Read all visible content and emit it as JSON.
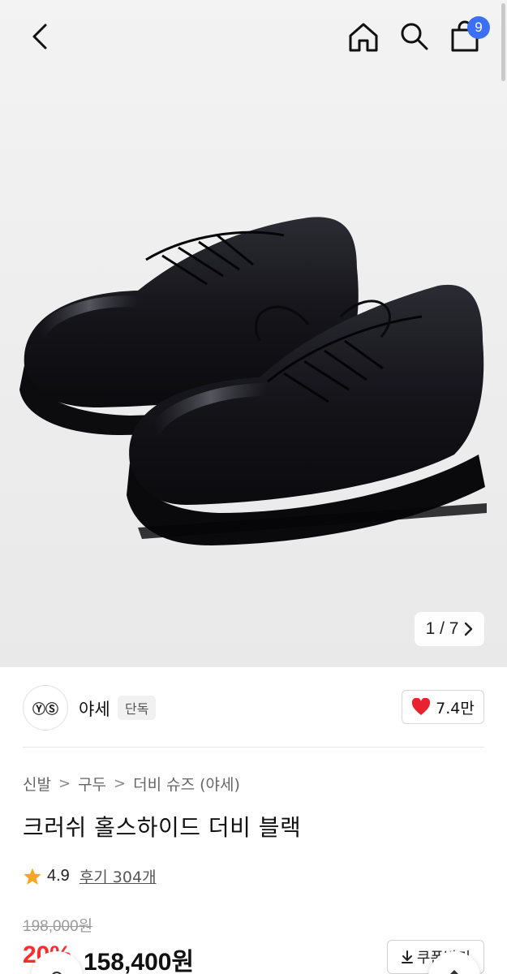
{
  "header": {
    "back_icon": "chevron-left-icon",
    "home_icon": "home-icon",
    "search_icon": "search-icon",
    "cart_icon": "shopping-bag-icon",
    "cart_count": "9",
    "badge_color": "#3b6ff6"
  },
  "gallery": {
    "pager": "1 / 7",
    "pager_icon": "chevron-right-icon"
  },
  "brand": {
    "logo_text": "ⓎⓈ",
    "name": "야세",
    "tag": "단독",
    "likes": "7.4만",
    "like_icon": "heart-icon",
    "heart_color": "#e8232f"
  },
  "breadcrumb": [
    "신발",
    "구두",
    "더비 슈즈 (야세)"
  ],
  "product": {
    "title": "크러쉬 홀스하이드 더비 블랙",
    "rating": "4.9",
    "reviews": "후기 304개",
    "star_color": "#f5a623",
    "original_price": "198,000원",
    "discount": "20%",
    "sale_price": "158,400원",
    "discount_color": "#ff2d2d",
    "coupon_label": "쿠폰받기",
    "coupon_icon": "download-icon"
  }
}
